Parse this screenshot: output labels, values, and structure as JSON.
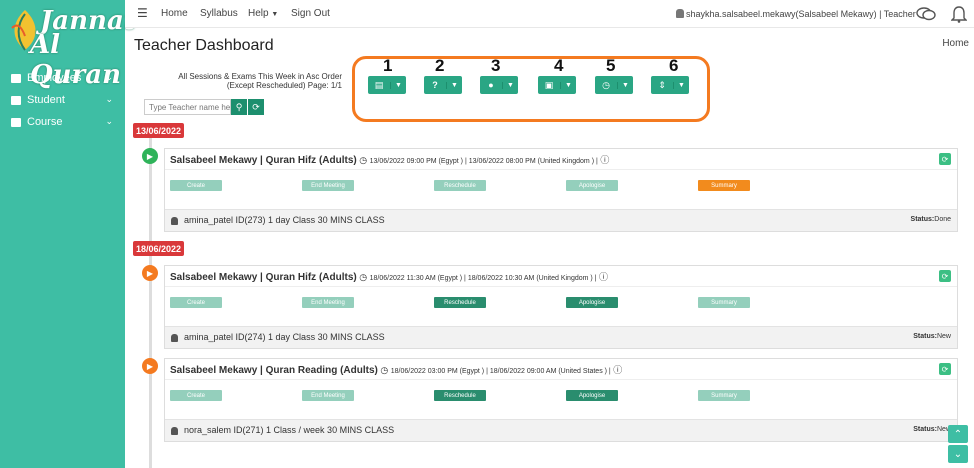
{
  "brand": {
    "line1": "Jannat",
    "line2": "Al Quran"
  },
  "sidebar": {
    "items": [
      {
        "label": "Employees",
        "icon": "briefcase-icon"
      },
      {
        "label": "Student",
        "icon": "student-icon"
      },
      {
        "label": "Course",
        "icon": "book-icon"
      }
    ]
  },
  "topnav": {
    "menu": "☰",
    "home": "Home",
    "syllabus": "Syllabus",
    "help": "Help",
    "signout": "Sign Out",
    "user": "shaykha.salsabeel.mekawy(Salsabeel Mekawy) | Teacher"
  },
  "page": {
    "title": "Teacher Dashboard",
    "breadcrumb": "Home",
    "order_text": "All Sessions & Exams This Week in Asc Order (Except Rescheduled) Page: 1/1"
  },
  "search": {
    "placeholder": "Type Teacher name here"
  },
  "filters": {
    "numbers": [
      "1",
      "2",
      "3",
      "4",
      "5",
      "6"
    ],
    "icons": [
      "list-icon",
      "question-icon",
      "user-icon",
      "calendar-icon",
      "clock-icon",
      "sort-icon"
    ]
  },
  "actions": {
    "create": "Create",
    "end_meeting": "End Meeting",
    "reschedule": "Reschedule",
    "apologise": "Apologise",
    "summary": "Summary"
  },
  "dates": [
    "13/06/2022",
    "18/06/2022"
  ],
  "sessions": [
    {
      "title": "Salsabeel Mekawy | Quran Hifz (Adults)",
      "time": "13/06/2022 09:00 PM (Egypt ) | 13/06/2022 08:00 PM (United Kingdom ) |",
      "student": "amina_patel ID(273) 1 day Class 30 MINS CLASS",
      "status_label": "Status:",
      "status": "Done",
      "icon_color": "#2fb35a"
    },
    {
      "title": "Salsabeel Mekawy | Quran Hifz (Adults)",
      "time": "18/06/2022 11:30 AM (Egypt ) | 18/06/2022 10:30 AM (United Kingdom ) |",
      "student": "amina_patel ID(274) 1 day Class 30 MINS CLASS",
      "status_label": "Status:",
      "status": "New",
      "icon_color": "#f47a20"
    },
    {
      "title": "Salsabeel Mekawy | Quran Reading (Adults)",
      "time": "18/06/2022 03:00 PM (Egypt ) | 18/06/2022 09:00 AM (United States ) |",
      "student": "nora_salem ID(271) 1 Class / week 30 MINS CLASS",
      "status_label": "Status:",
      "status": "New",
      "icon_color": "#f47a20"
    }
  ]
}
